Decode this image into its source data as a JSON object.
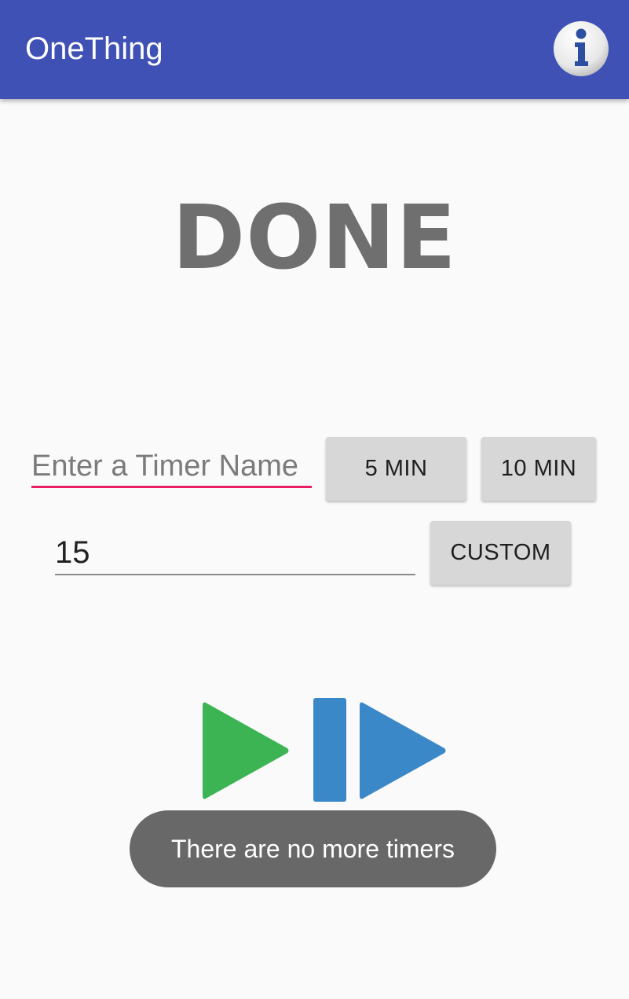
{
  "app": {
    "title": "OneThing",
    "info_icon": "info-icon"
  },
  "timer": {
    "status": "DONE",
    "name_placeholder": "Enter a Timer Name",
    "name_value": "",
    "custom_minutes_value": "15"
  },
  "buttons": {
    "five_min": "5 MIN",
    "ten_min": "10 MIN",
    "custom": "CUSTOM"
  },
  "controls": {
    "play_icon": "play-icon",
    "pause_icon": "pause-icon",
    "skip_icon": "skip-next-icon",
    "play_color": "#3cb454",
    "pause_color": "#3a88c8",
    "skip_color": "#3a88c8"
  },
  "toast": {
    "message": "There are no more timers"
  },
  "colors": {
    "appbar": "#3f51b5",
    "accent": "#e91e63",
    "status_text": "#6f6f6f"
  }
}
